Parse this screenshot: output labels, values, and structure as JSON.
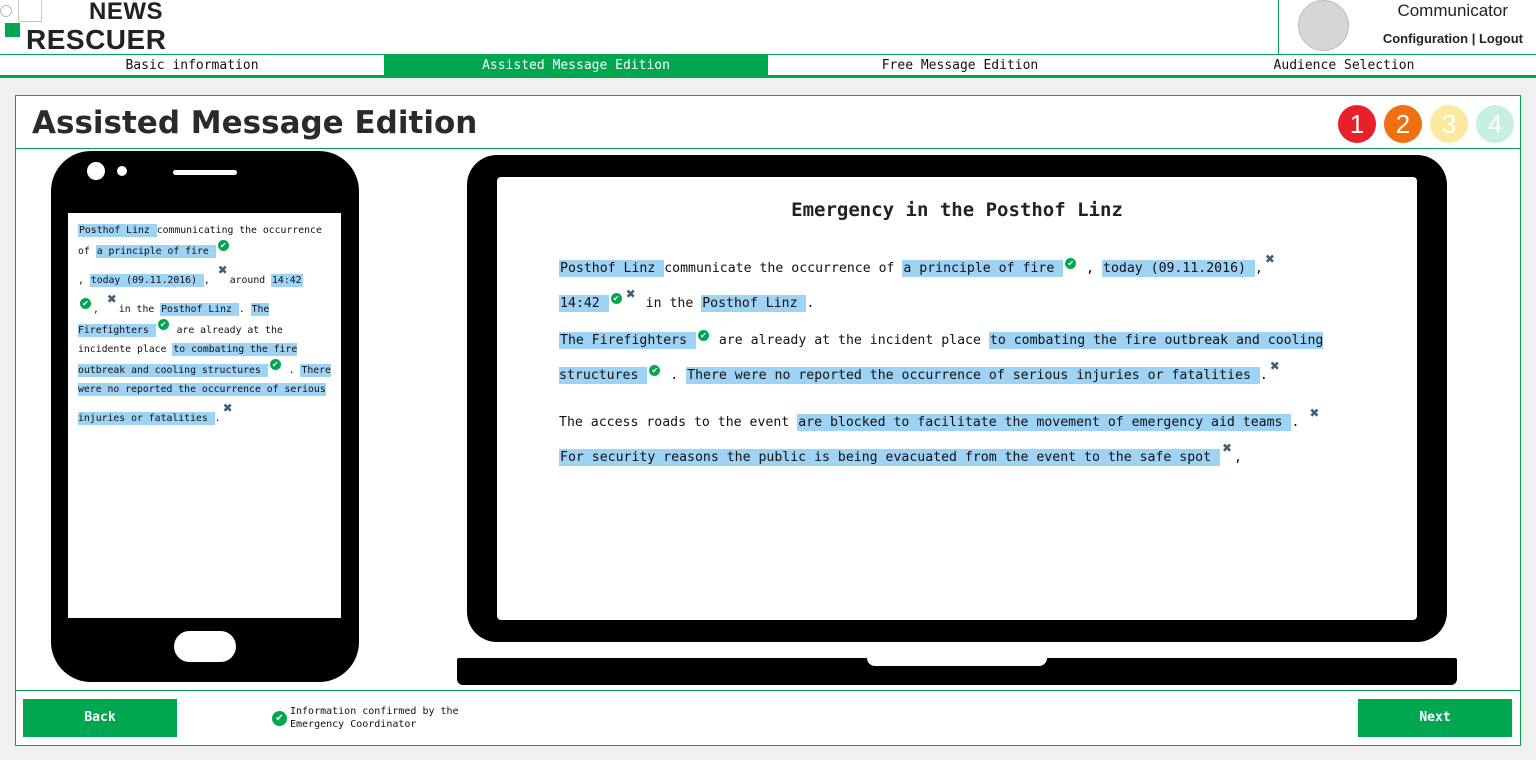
{
  "header": {
    "logo_line1": "NEWS",
    "logo_line2": "RESCUER",
    "user_role": "Communicator",
    "config_link": "Configuration",
    "separator": "|",
    "logout_link": "Logout"
  },
  "tabs": [
    {
      "label": "Basic information",
      "active": false
    },
    {
      "label": "Assisted Message Edition",
      "active": true
    },
    {
      "label": "Free Message Edition",
      "active": false
    },
    {
      "label": "Audience Selection",
      "active": false
    }
  ],
  "page": {
    "title": "Assisted Message Edition",
    "steps": [
      {
        "label": "1",
        "color": "#e8202a"
      },
      {
        "label": "2",
        "color": "#f07010"
      },
      {
        "label": "3",
        "color": "#fbe9a0"
      },
      {
        "label": "4",
        "color": "#c8f0e0"
      }
    ]
  },
  "phone": {
    "t1": "Posthof Linz ",
    "t2": "communicating the occurrence of  ",
    "t3": "a principle of fire ",
    "t4": ", ",
    "t5": "today (09.11.2016) ",
    "t6": ", ",
    "t7": "around ",
    "t8": "14:42",
    "t9": ", ",
    "t10": "in the ",
    "t11": "Posthof Linz ",
    "t12": ". ",
    "t13": "The Firefighters ",
    "t14": "  are already at the incidente place ",
    "t15": "to combating the fire outbreak and cooling structures ",
    "t16": " . ",
    "t17": "There were no reported the occurrence of serious injuries or fatalities ",
    "t18": "."
  },
  "laptop": {
    "title": "Emergency in the Posthof Linz",
    "p1": {
      "a": "Posthof Linz ",
      "b": "communicate the occurrence of  ",
      "c": "a principle of fire ",
      "d": " , ",
      "e": "today (09.11.2016) ",
      "f": ",",
      "g": "14:42 ",
      "h": " in the ",
      "i": "Posthof Linz ",
      "j": "."
    },
    "p2": {
      "a": "The Firefighters ",
      "b": "  are already at the incident place ",
      "c": "to combating the fire outbreak and cooling structures ",
      "d": " .  ",
      "e": "There were no reported the occurrence of serious injuries or fatalities ",
      "f": "."
    },
    "p3": {
      "a": "The access roads to the event ",
      "b": "are blocked to facilitate the movement of emergency aid teams ",
      "c": ". ",
      "d": "For security reasons the public is being evacuated from the event to the safe spot ",
      "e": ","
    }
  },
  "footer": {
    "back_label": "Back",
    "next_label": "Next",
    "legend_text": "Information confirmed by the Emergency Coordinator"
  },
  "icons": {
    "check": "✔",
    "remove": "✖"
  }
}
